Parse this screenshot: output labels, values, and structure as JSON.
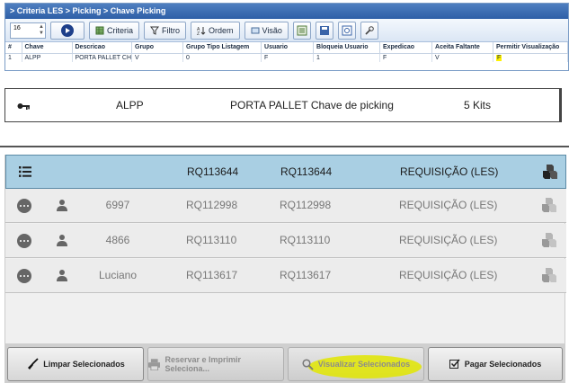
{
  "breadcrumb": "> Criteria LES > Picking > Chave Picking",
  "toolbar": {
    "spinner_value": "16",
    "criteria_label": "Criteria",
    "filtro_label": "Filtro",
    "ordem_label": "Ordem",
    "visao_label": "Visão"
  },
  "grid": {
    "headers": [
      "#",
      "Chave",
      "Descricao",
      "Grupo",
      "Grupo Tipo Listagem",
      "Usuario",
      "Bloqueia Usuario",
      "Expedicao",
      "Aceita Faltante",
      "Permitir Visualização"
    ],
    "row": [
      "1",
      "ALPP",
      "PORTA PALLET CH",
      "V",
      "0",
      "F",
      "1",
      "F",
      "V",
      "F"
    ]
  },
  "info": {
    "chave": "ALPP",
    "descricao": "PORTA PALLET Chave de picking",
    "kits": "5 Kits"
  },
  "list": {
    "header": {
      "req1": "RQ113644",
      "req2": "RQ113644",
      "type": "REQUISIÇÃO (LES)"
    },
    "rows": [
      {
        "user": "6997",
        "req1": "RQ112998",
        "req2": "RQ112998",
        "type": "REQUISIÇÃO (LES)"
      },
      {
        "user": "4866",
        "req1": "RQ113110",
        "req2": "RQ113110",
        "type": "REQUISIÇÃO (LES)"
      },
      {
        "user": "Luciano",
        "req1": "RQ113617",
        "req2": "RQ113617",
        "type": "REQUISIÇÃO (LES)"
      }
    ]
  },
  "actions": {
    "limpar": "Limpar Selecionados",
    "reservar": "Reservar e Imprimir Seleciona...",
    "visualizar": "Visualizar Selecionados",
    "pagar": "Pagar Selecionados"
  },
  "colors": {
    "header_row": "#a9cfe3",
    "highlight": "#e2e600",
    "breadcrumb": "#2e5fa7"
  },
  "icons": [
    "key-icon",
    "list-icon",
    "more-icon",
    "person-icon",
    "boxes-icon",
    "broom-icon",
    "printer-icon",
    "search-icon",
    "checkbox-icon"
  ]
}
